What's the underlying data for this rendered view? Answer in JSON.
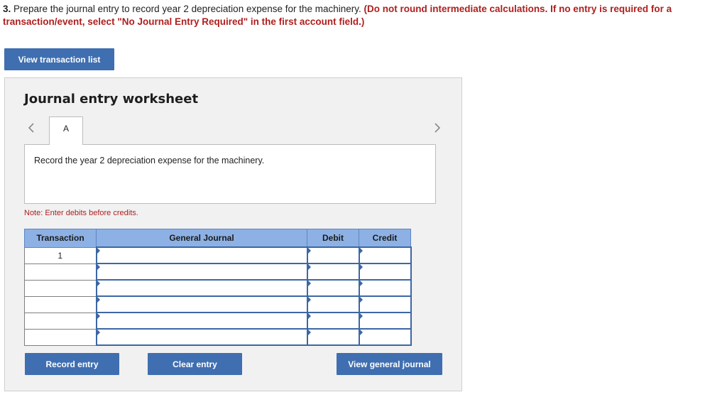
{
  "question": {
    "number": "3.",
    "text": " Prepare the journal entry to record year 2 depreciation expense for the machinery. ",
    "instruction": "(Do not round intermediate calculations. If no entry is required for a transaction/event, select \"No Journal Entry Required\" in the first account field.)"
  },
  "top_button_label": "View transaction list",
  "worksheet": {
    "title": "Journal entry worksheet",
    "tab_label": "A",
    "description": "Record the year 2 depreciation expense for the machinery.",
    "note": "Note: Enter debits before credits.",
    "columns": [
      "Transaction",
      "General Journal",
      "Debit",
      "Credit"
    ],
    "rows": [
      {
        "transaction": "1"
      },
      {
        "transaction": ""
      },
      {
        "transaction": ""
      },
      {
        "transaction": ""
      },
      {
        "transaction": ""
      },
      {
        "transaction": ""
      }
    ]
  },
  "buttons": {
    "record": "Record entry",
    "clear": "Clear entry",
    "view_journal": "View general journal"
  },
  "colors": {
    "button": "#3f6fb0",
    "header": "#8db1e4",
    "warning": "#b01e1e"
  }
}
